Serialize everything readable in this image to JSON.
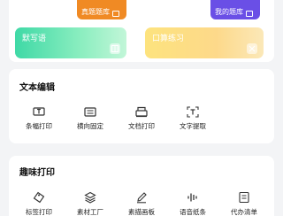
{
  "top": {
    "banner_left": "真题题库",
    "banner_right": "我的题库",
    "tile_left": "默写语",
    "tile_right": "口算练习"
  },
  "text_edit": {
    "title": "文本编辑",
    "tools": [
      {
        "label": "条幅打印",
        "icon": "banner-print-icon"
      },
      {
        "label": "横向固定",
        "icon": "horizontal-fix-icon"
      },
      {
        "label": "文档打印",
        "icon": "document-print-icon"
      },
      {
        "label": "文字提取",
        "icon": "text-extract-icon"
      }
    ]
  },
  "fun_print": {
    "title": "趣味打印",
    "tools": [
      {
        "label": "标签打印",
        "icon": "tag-icon"
      },
      {
        "label": "素材工厂",
        "icon": "layers-icon"
      },
      {
        "label": "素描画板",
        "icon": "pencil-icon"
      },
      {
        "label": "语音纸条",
        "icon": "voice-wave-icon"
      },
      {
        "label": "代办清单",
        "icon": "checklist-icon"
      }
    ]
  }
}
